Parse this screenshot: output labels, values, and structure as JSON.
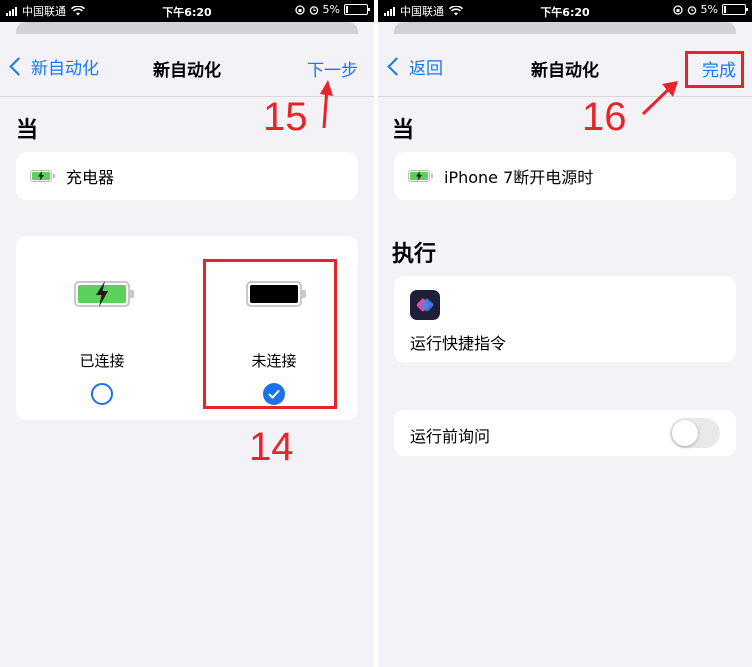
{
  "status_bar": {
    "carrier": "中国联通",
    "time": "下午6:20",
    "battery_percent": "5%"
  },
  "left_screen": {
    "back_label": "新自动化",
    "title": "新自动化",
    "next_label": "下一步",
    "when_header": "当",
    "trigger_label": "充电器",
    "options": [
      {
        "label": "已连接",
        "selected": false
      },
      {
        "label": "未连接",
        "selected": true
      }
    ]
  },
  "right_screen": {
    "back_label": "返回",
    "title": "新自动化",
    "done_label": "完成",
    "when_header": "当",
    "trigger_label": "iPhone 7断开电源时",
    "do_header": "执行",
    "action_label": "运行快捷指令",
    "ask_before_running_label": "运行前询问",
    "ask_before_running_on": false
  },
  "annotations": {
    "step_14": "14",
    "step_15": "15",
    "step_16": "16",
    "color": "#e8242b"
  },
  "colors": {
    "accent": "#1778f2",
    "battery_green": "#5ad15a",
    "annotation_red": "#e8242b"
  },
  "icons": [
    "wifi-icon",
    "signal-icon",
    "battery-icon",
    "alarm-icon",
    "lock-rotation-icon",
    "charging-battery-icon",
    "empty-battery-icon",
    "shortcuts-app-icon",
    "checkmark-icon"
  ]
}
